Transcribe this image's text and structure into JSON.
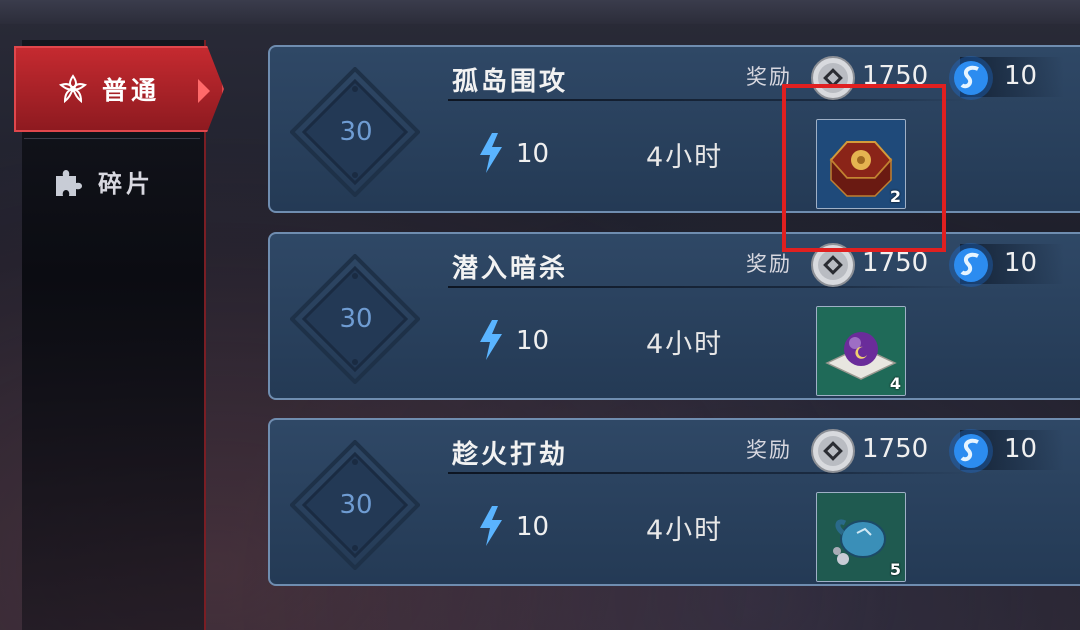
{
  "sidebar": {
    "tabs": [
      {
        "label": "普通",
        "icon": "flower-icon",
        "active": true
      },
      {
        "label": "碎片",
        "icon": "puzzle-icon",
        "active": false
      }
    ]
  },
  "missions": [
    {
      "name": "孤岛围攻",
      "level": "30",
      "energy": "10",
      "time": "4小时",
      "reward_label": "奖励",
      "coins": "1750",
      "gems": "10",
      "item_icon": "treasure-chest-icon",
      "item_qty": "2"
    },
    {
      "name": "潜入暗杀",
      "level": "30",
      "energy": "10",
      "time": "4小时",
      "reward_label": "奖励",
      "coins": "1750",
      "gems": "10",
      "item_icon": "purple-orb-icon",
      "item_qty": "4"
    },
    {
      "name": "趁火打劫",
      "level": "30",
      "energy": "10",
      "time": "4小时",
      "reward_label": "奖励",
      "coins": "1750",
      "gems": "10",
      "item_icon": "pouch-icon",
      "item_qty": "5"
    }
  ],
  "colors": {
    "accent": "#c52a30",
    "card": "#2f4866",
    "highlight": "#e02020"
  }
}
